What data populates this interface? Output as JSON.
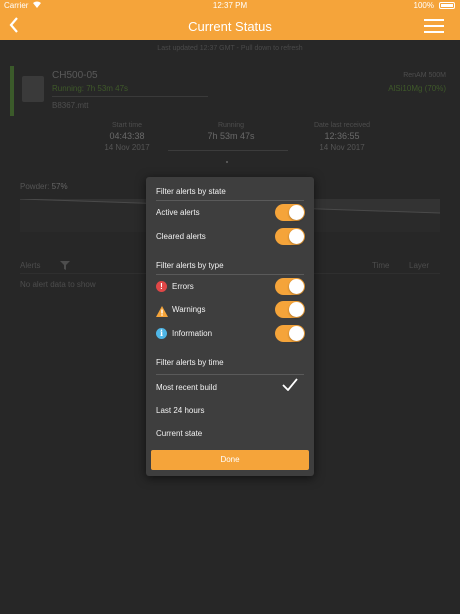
{
  "status_bar": {
    "carrier": "Carrier",
    "time": "12:37 PM",
    "battery": "100%"
  },
  "nav": {
    "title": "Current Status"
  },
  "background": {
    "last_updated": "Last updated 12:37 GMT - Pull down to refresh",
    "machine": {
      "name": "CH500-05",
      "running": "Running: 7h 53m 47s",
      "build": "B8367.mtt",
      "material": "RenAM 500M",
      "material_status": "AlSi10Mg (70%)"
    },
    "times": {
      "start_label": "Start time",
      "start_value": "04:43:38",
      "start_date": "14 Nov 2017",
      "running_label": "Running",
      "running_value": "7h 53m 47s",
      "received_label": "Date last received",
      "received_value": "12:36:55",
      "received_date": "14 Nov 2017"
    },
    "powder_label": "Powder:",
    "powder_value": "57%",
    "alerts_header": "Alerts",
    "time_header": "Time",
    "layer_header": "Layer",
    "no_alerts": "No alert data to show"
  },
  "filter": {
    "state_header": "Filter alerts by state",
    "state": [
      {
        "label": "Active alerts",
        "on": true
      },
      {
        "label": "Cleared alerts",
        "on": true
      }
    ],
    "type_header": "Filter alerts by type",
    "types": [
      {
        "label": "Errors",
        "icon": "error-icon",
        "on": true
      },
      {
        "label": "Warnings",
        "icon": "warning-icon",
        "on": true
      },
      {
        "label": "Information",
        "icon": "info-icon",
        "on": true
      }
    ],
    "time_header": "Filter alerts by time",
    "times": [
      {
        "label": "Most recent build",
        "selected": true
      },
      {
        "label": "Last 24 hours",
        "selected": false
      },
      {
        "label": "Current state",
        "selected": false
      }
    ],
    "done_label": "Done"
  },
  "colors": {
    "accent": "#f5a43a",
    "error": "#e04747",
    "warning": "#f5a43a",
    "info": "#4fb6e6"
  }
}
